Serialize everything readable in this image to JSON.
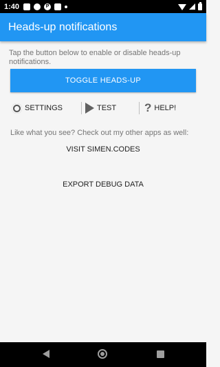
{
  "status_bar": {
    "time": "1:40",
    "icons": [
      "notification-icon",
      "notification-icon",
      "p-icon",
      "image-icon",
      "dot-icon",
      "wifi-icon",
      "signal-icon",
      "battery-icon"
    ],
    "p_letter": "P"
  },
  "app_bar": {
    "title": "Heads-up notifications",
    "color": "#2196f3"
  },
  "main": {
    "description": "Tap the button below to enable or disable heads-up notifications.",
    "toggle_label": "TOGGLE HEADS-UP",
    "actions": {
      "settings": {
        "label": "SETTINGS",
        "icon": "gear-icon"
      },
      "test": {
        "label": "TEST",
        "icon": "play-icon"
      },
      "help": {
        "label": "HELP!",
        "icon": "question-icon"
      }
    },
    "promo_text": "Like what you see? Check out my other apps as well:",
    "visit_label": "VISIT SIMEN.CODES",
    "export_label": "EXPORT DEBUG DATA"
  },
  "nav_bar": {
    "buttons": [
      "back-icon",
      "home-icon",
      "recents-icon"
    ]
  }
}
